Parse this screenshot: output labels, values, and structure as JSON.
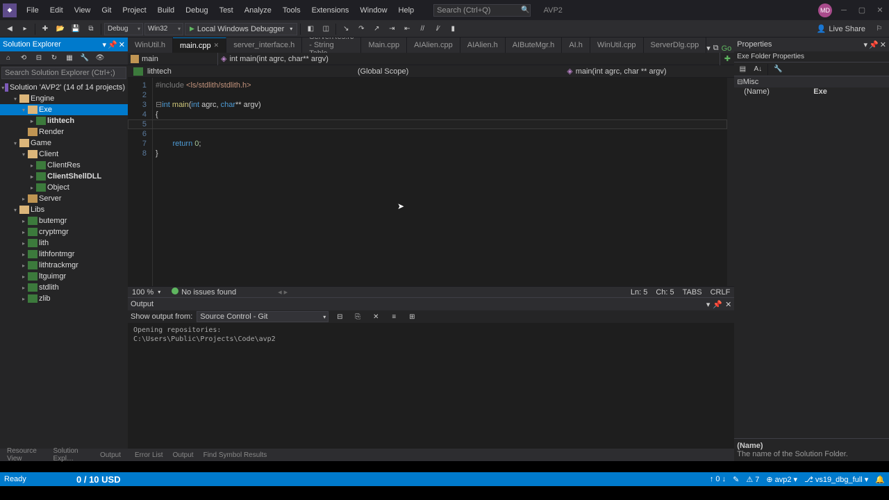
{
  "menu": [
    "File",
    "Edit",
    "View",
    "Git",
    "Project",
    "Build",
    "Debug",
    "Test",
    "Analyze",
    "Tools",
    "Extensions",
    "Window",
    "Help"
  ],
  "search_placeholder": "Search (Ctrl+Q)",
  "app_title": "AVP2",
  "user_initials": "MD",
  "toolbar": {
    "config": "Debug",
    "platform": "Win32",
    "debugger": "Local Windows Debugger"
  },
  "liveshare": "Live Share",
  "sol": {
    "title": "Solution Explorer",
    "search_placeholder": "Search Solution Explorer (Ctrl+;)",
    "root": "Solution 'AVP2' (14 of 14 projects)",
    "tree": [
      {
        "d": 1,
        "exp": "▾",
        "icon": "fi-folder-open",
        "label": "Engine"
      },
      {
        "d": 2,
        "exp": "▾",
        "icon": "fi-folder-open",
        "label": "Exe",
        "sel": true
      },
      {
        "d": 3,
        "exp": "▸",
        "icon": "fi-cpp",
        "label": "lithtech",
        "bold": true
      },
      {
        "d": 2,
        "exp": "",
        "icon": "fi-folder",
        "label": "Render"
      },
      {
        "d": 1,
        "exp": "▾",
        "icon": "fi-folder-open",
        "label": "Game"
      },
      {
        "d": 2,
        "exp": "▾",
        "icon": "fi-folder-open",
        "label": "Client"
      },
      {
        "d": 3,
        "exp": "▸",
        "icon": "fi-cpp",
        "label": "ClientRes"
      },
      {
        "d": 3,
        "exp": "▸",
        "icon": "fi-cpp",
        "label": "ClientShellDLL",
        "bold": true
      },
      {
        "d": 3,
        "exp": "▸",
        "icon": "fi-cpp",
        "label": "Object"
      },
      {
        "d": 2,
        "exp": "▸",
        "icon": "fi-folder",
        "label": "Server"
      },
      {
        "d": 1,
        "exp": "▾",
        "icon": "fi-folder-open",
        "label": "Libs"
      },
      {
        "d": 2,
        "exp": "▸",
        "icon": "fi-cpp",
        "label": "butemgr"
      },
      {
        "d": 2,
        "exp": "▸",
        "icon": "fi-cpp",
        "label": "cryptmgr"
      },
      {
        "d": 2,
        "exp": "▸",
        "icon": "fi-cpp",
        "label": "lith"
      },
      {
        "d": 2,
        "exp": "▸",
        "icon": "fi-cpp",
        "label": "lithfontmgr"
      },
      {
        "d": 2,
        "exp": "▸",
        "icon": "fi-cpp",
        "label": "lithtrackmgr"
      },
      {
        "d": 2,
        "exp": "▸",
        "icon": "fi-cpp",
        "label": "ltguimgr"
      },
      {
        "d": 2,
        "exp": "▸",
        "icon": "fi-cpp",
        "label": "stdlith"
      },
      {
        "d": 2,
        "exp": "▸",
        "icon": "fi-cpp",
        "label": "zlib"
      }
    ],
    "bottom_tabs": [
      "Resource View",
      "Solution Expl…",
      "Output"
    ]
  },
  "tabs": [
    {
      "label": "WinUtil.h",
      "active": false
    },
    {
      "label": "main.cpp",
      "active": true
    },
    {
      "label": "server_interface.h"
    },
    {
      "label": "ServerRes.rc - String Table"
    },
    {
      "label": "Main.cpp"
    },
    {
      "label": "AIAlien.cpp"
    },
    {
      "label": "AIAlien.h"
    },
    {
      "label": "AIButeMgr.h"
    },
    {
      "label": "AI.h"
    },
    {
      "label": "WinUtil.cpp"
    },
    {
      "label": "ServerDlg.cpp"
    }
  ],
  "tab_right": "Go",
  "nav": {
    "proj": "main",
    "func": "int main(int agrc, char** argv)"
  },
  "breadcrumb": {
    "proj": "lithtech",
    "scope": "(Global Scope)",
    "func": "main(int agrc, char ** argv)"
  },
  "code": {
    "lines": [
      "1",
      "2",
      "3",
      "4",
      "5",
      "6",
      "7",
      "8"
    ],
    "l1_a": "#include ",
    "l1_b": "<ls/stdlith/stdlith.h>",
    "l3_a": "int ",
    "l3_b": "main",
    "l3_c": "(",
    "l3_d": "int ",
    "l3_e": "agrc, ",
    "l3_f": "char",
    "l3_g": "** argv)",
    "l4": "{",
    "l7_a": "        return ",
    "l7_b": "0",
    "l7_c": ";",
    "l8": "}"
  },
  "editor_status": {
    "zoom": "100 %",
    "issues": "No issues found",
    "ln": "Ln: 5",
    "ch": "Ch: 5",
    "tabs": "TABS",
    "crlf": "CRLF"
  },
  "output": {
    "title": "Output",
    "from_label": "Show output from:",
    "from_value": "Source Control - Git",
    "text": "Opening repositories:\nC:\\Users\\Public\\Projects\\Code\\avp2",
    "bottom_tabs": [
      "Error List",
      "Output",
      "Find Symbol Results"
    ]
  },
  "props": {
    "title": "Properties",
    "type": "Exe  Folder Properties",
    "cat": "Misc",
    "name_key": "(Name)",
    "name_val": "Exe",
    "desc_name": "(Name)",
    "desc_text": "The name of the Solution Folder."
  },
  "status": {
    "ready": "Ready",
    "items": [
      "↑ 0 ↓",
      "✎",
      "⚠ 7",
      "⊕ avp2 ▾",
      "⎇ vs19_dbg_full ▾",
      "🔔"
    ]
  },
  "overlay": "0 / 10 USD"
}
